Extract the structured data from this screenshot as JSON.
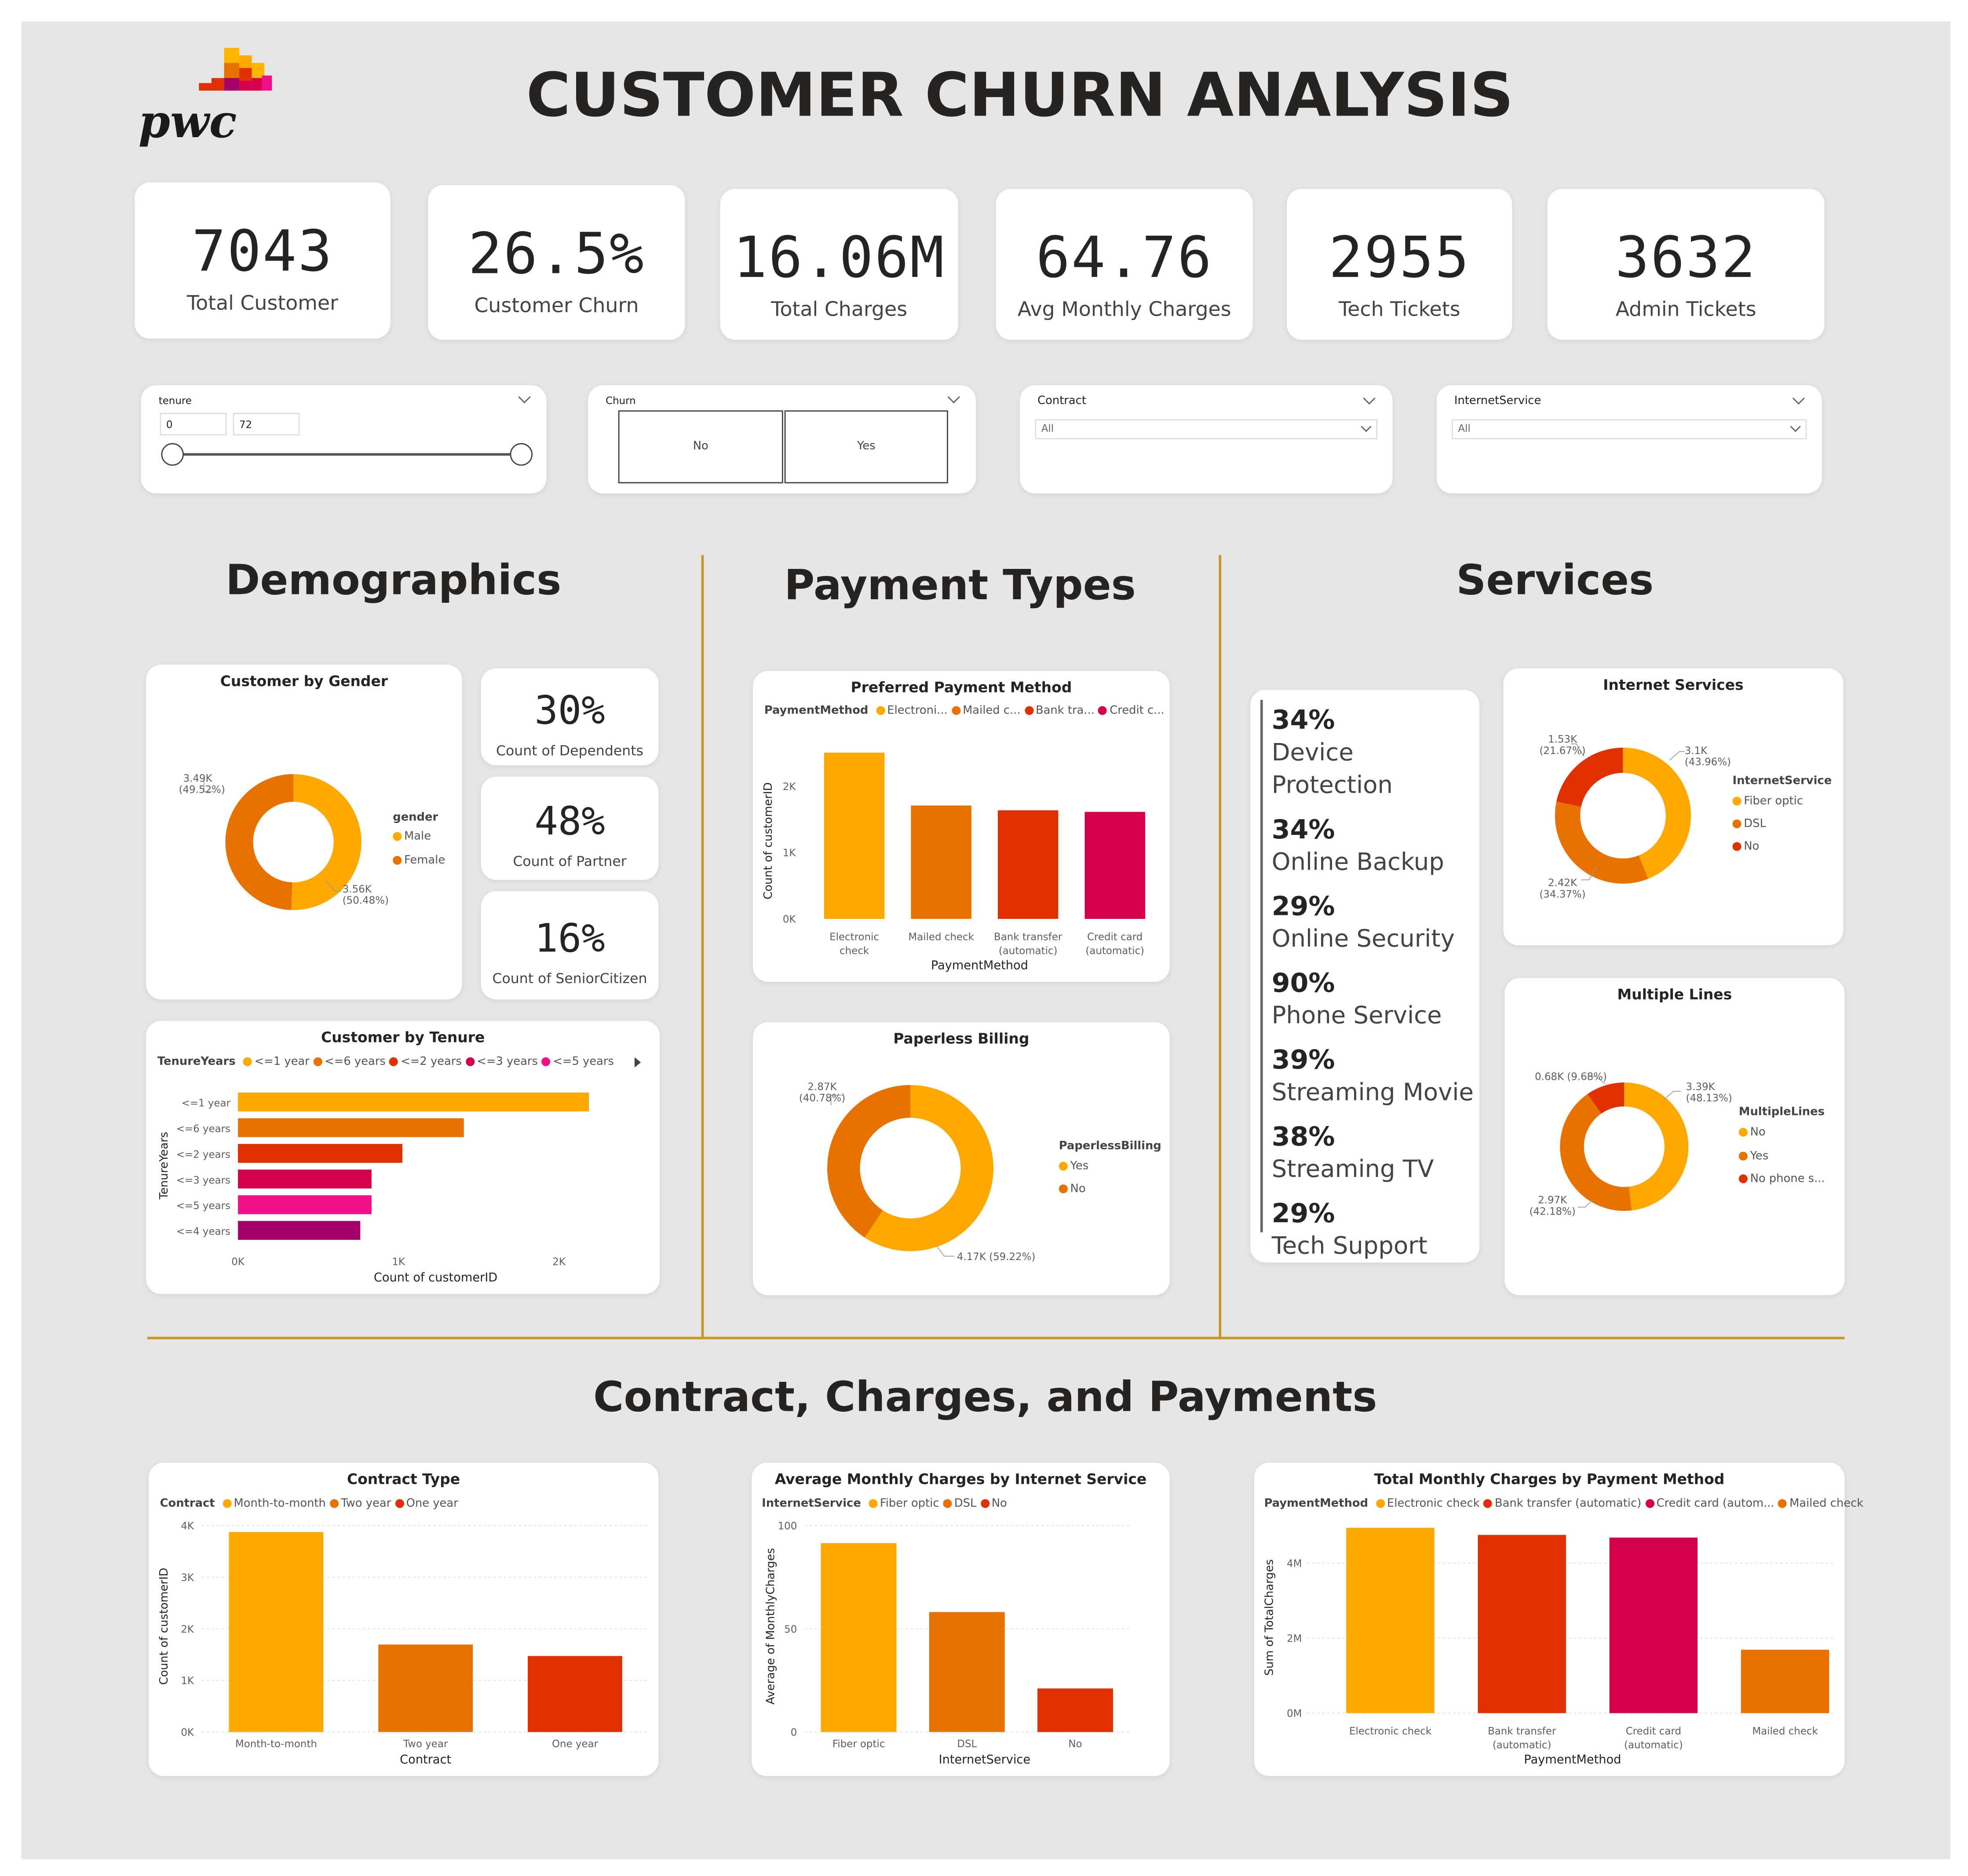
{
  "header": {
    "brand": "pwc",
    "title": "CUSTOMER CHURN ANALYSIS"
  },
  "kpis": [
    {
      "value": "7043",
      "label": "Total Customer"
    },
    {
      "value": "26.5%",
      "label": "Customer Churn"
    },
    {
      "value": "16.06M",
      "label": "Total Charges"
    },
    {
      "value": "64.76",
      "label": "Avg Monthly Charges"
    },
    {
      "value": "2955",
      "label": "Tech Tickets"
    },
    {
      "value": "3632",
      "label": "Admin Tickets"
    }
  ],
  "slicers": {
    "tenure": {
      "label": "tenure",
      "min": "0",
      "max": "72"
    },
    "churn": {
      "label": "Churn",
      "options": [
        "No",
        "Yes"
      ]
    },
    "contract": {
      "label": "Contract",
      "selected": "All"
    },
    "internet": {
      "label": "InternetService",
      "selected": "All"
    }
  },
  "sections": {
    "demographics": "Demographics",
    "payment": "Payment Types",
    "services": "Services",
    "contract": "Contract, Charges, and Payments"
  },
  "colors": {
    "orange": "#FFA800",
    "dark_orange": "#E97100",
    "red": "#E03000",
    "crimson": "#D4004C",
    "pink": "#F0108A",
    "purple": "#A6006A"
  },
  "gender": {
    "title": "Customer by Gender",
    "legend_title": "gender",
    "legend": [
      "Male",
      "Female"
    ],
    "label_male": "3.56K",
    "label_male_pct": "(50.48%)",
    "label_female": "3.49K",
    "label_female_pct": "(49.52%)"
  },
  "demo_stats": [
    {
      "value": "30%",
      "label": "Count of Dependents"
    },
    {
      "value": "48%",
      "label": "Count of Partner"
    },
    {
      "value": "16%",
      "label": "Count of SeniorCitizen"
    }
  ],
  "services_list": [
    {
      "pct": "34%",
      "name": "Device Protection"
    },
    {
      "pct": "34%",
      "name": "Online Backup"
    },
    {
      "pct": "29%",
      "name": "Online Security"
    },
    {
      "pct": "90%",
      "name": "Phone Service"
    },
    {
      "pct": "39%",
      "name": "Streaming Movie"
    },
    {
      "pct": "38%",
      "name": "Streaming TV"
    },
    {
      "pct": "29%",
      "name": "Tech Support"
    }
  ],
  "tenure_chart": {
    "title": "Customer by Tenure",
    "legend_title": "TenureYears",
    "legend": [
      "<=1 year",
      "<=6 years",
      "<=2 years",
      "<=3 years",
      "<=5 years"
    ],
    "ylabel": "TenureYears",
    "xlabel": "Count of customerID"
  },
  "payment_chart": {
    "title": "Preferred Payment Method",
    "legend_title": "PaymentMethod",
    "legend": [
      "Electroni...",
      "Mailed c...",
      "Bank tra...",
      "Credit c..."
    ],
    "ylabel": "Count of customerID",
    "xlabel": "PaymentMethod"
  },
  "paperless": {
    "title": "Paperless Billing",
    "legend_title": "PaperlessBilling",
    "legend": [
      "Yes",
      "No"
    ],
    "label_yes": "4.17K (59.22%)",
    "label_no": "2.87K",
    "label_no_pct": "(40.78%)"
  },
  "internet_donut": {
    "title": "Internet Services",
    "legend_title": "InternetService",
    "legend": [
      "Fiber optic",
      "DSL",
      "No"
    ],
    "label_fiber": "3.1K",
    "label_fiber_pct": "(43.96%)",
    "label_dsl": "2.42K",
    "label_dsl_pct": "(34.37%)",
    "label_no": "1.53K",
    "label_no_pct": "(21.67%)"
  },
  "multilines": {
    "title": "Multiple Lines",
    "legend_title": "MultipleLines",
    "legend": [
      "No",
      "Yes",
      "No phone s..."
    ],
    "label_no": "3.39K",
    "label_no_pct": "(48.13%)",
    "label_yes": "2.97K",
    "label_yes_pct": "(42.18%)",
    "label_nophone": "0.68K (9.68%)"
  },
  "contract_chart": {
    "title": "Contract Type",
    "legend_title": "Contract",
    "legend": [
      "Month-to-month",
      "Two year",
      "One year"
    ],
    "ylabel": "Count of customerID",
    "xlabel": "Contract"
  },
  "avg_charges_chart": {
    "title": "Average Monthly Charges by Internet Service",
    "legend_title": "InternetService",
    "legend": [
      "Fiber optic",
      "DSL",
      "No"
    ],
    "ylabel": "Average of MonthlyCharges",
    "xlabel": "InternetService"
  },
  "total_charges_chart": {
    "title": "Total Monthly Charges by Payment Method",
    "legend_title": "PaymentMethod",
    "legend": [
      "Electronic check",
      "Bank transfer (automatic)",
      "Credit card (autom...",
      "Mailed check"
    ],
    "ylabel": "Sum of TotalCharges",
    "xlabel": "PaymentMethod"
  },
  "chart_data": [
    {
      "id": "gender",
      "type": "pie",
      "title": "Customer by Gender",
      "categories": [
        "Male",
        "Female"
      ],
      "values": [
        3555,
        3488
      ],
      "colors": [
        "#FFA800",
        "#E97100"
      ]
    },
    {
      "id": "tenure",
      "type": "bar",
      "orientation": "horizontal",
      "title": "Customer by Tenure",
      "categories": [
        "<=1 year",
        "<=6 years",
        "<=2 years",
        "<=3 years",
        "<=5 years",
        "<=4 years"
      ],
      "values": [
        2186,
        1407,
        1024,
        832,
        832,
        762
      ],
      "xlim": [
        0,
        2300
      ],
      "xticks": [
        "0K",
        "1K",
        "2K"
      ],
      "xlabel": "Count of customerID",
      "ylabel": "TenureYears",
      "colors": [
        "#FFA800",
        "#E97100",
        "#E03000",
        "#D4004C",
        "#F0108A",
        "#A6006A"
      ]
    },
    {
      "id": "payment",
      "type": "bar",
      "title": "Preferred Payment Method",
      "categories": [
        "Electronic check",
        "Mailed check",
        "Bank transfer (automatic)",
        "Credit card (automatic)"
      ],
      "values": [
        2365,
        1612,
        1544,
        1522
      ],
      "ylim": [
        0,
        2600
      ],
      "yticks": [
        "0K",
        "1K",
        "2K"
      ],
      "xlabel": "PaymentMethod",
      "ylabel": "Count of customerID",
      "colors": [
        "#FFA800",
        "#E97100",
        "#E03000",
        "#D4004C"
      ]
    },
    {
      "id": "paperless",
      "type": "pie",
      "title": "Paperless Billing",
      "categories": [
        "Yes",
        "No"
      ],
      "values": [
        4171,
        2872
      ],
      "colors": [
        "#FFA800",
        "#E97100"
      ]
    },
    {
      "id": "internet",
      "type": "pie",
      "title": "Internet Services",
      "categories": [
        "Fiber optic",
        "DSL",
        "No"
      ],
      "values": [
        3096,
        2421,
        1526
      ],
      "colors": [
        "#FFA800",
        "#E97100",
        "#E03000"
      ]
    },
    {
      "id": "multilines",
      "type": "pie",
      "title": "Multiple Lines",
      "categories": [
        "No",
        "Yes",
        "No phone service"
      ],
      "values": [
        3390,
        2971,
        682
      ],
      "colors": [
        "#FFA800",
        "#E97100",
        "#E03000"
      ]
    },
    {
      "id": "contract",
      "type": "bar",
      "title": "Contract Type",
      "categories": [
        "Month-to-month",
        "Two year",
        "One year"
      ],
      "values": [
        3875,
        1695,
        1473
      ],
      "ylim": [
        0,
        4000
      ],
      "yticks": [
        "0K",
        "1K",
        "2K",
        "3K",
        "4K"
      ],
      "xlabel": "Contract",
      "ylabel": "Count of customerID",
      "colors": [
        "#FFA800",
        "#E97100",
        "#E03000"
      ]
    },
    {
      "id": "avgcharges",
      "type": "bar",
      "title": "Average Monthly Charges by Internet Service",
      "categories": [
        "Fiber optic",
        "DSL",
        "No"
      ],
      "values": [
        91.5,
        58.1,
        21.1
      ],
      "ylim": [
        0,
        100
      ],
      "yticks": [
        "0",
        "50",
        "100"
      ],
      "xlabel": "InternetService",
      "ylabel": "Average of MonthlyCharges",
      "colors": [
        "#FFA800",
        "#E97100",
        "#E03000"
      ]
    },
    {
      "id": "totalcharges",
      "type": "bar",
      "title": "Total Monthly Charges by Payment Method",
      "categories": [
        "Electronic check",
        "Bank transfer (automatic)",
        "Credit card (automatic)",
        "Mailed check"
      ],
      "values": [
        4940000,
        4750000,
        4680000,
        1690000
      ],
      "ylim": [
        0,
        5000000
      ],
      "yticks": [
        "0M",
        "2M",
        "4M"
      ],
      "xlabel": "PaymentMethod",
      "ylabel": "Sum of TotalCharges",
      "colors": [
        "#FFA800",
        "#E03000",
        "#D4004C",
        "#E97100"
      ]
    }
  ]
}
